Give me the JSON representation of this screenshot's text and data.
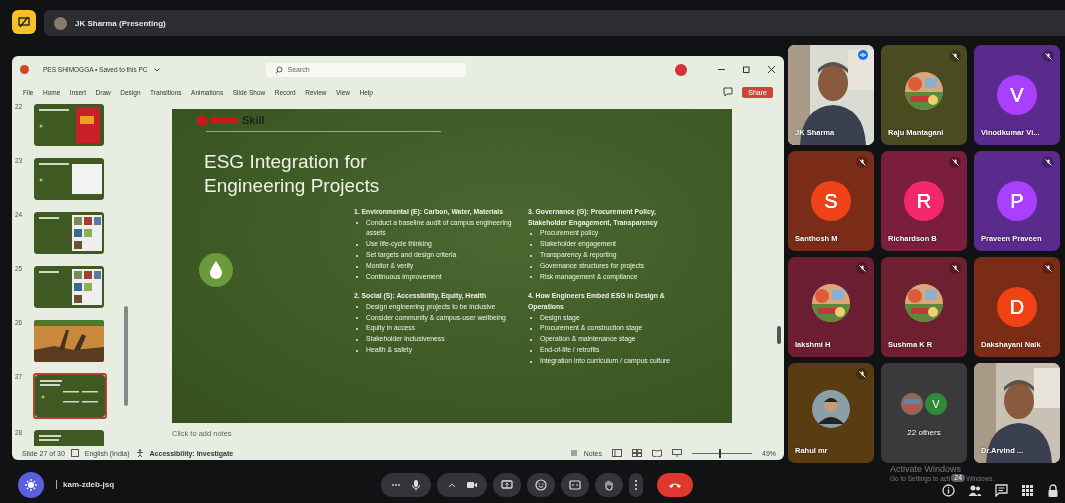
{
  "top_bar": {
    "presenter_label": "JK Sharma (Presenting)"
  },
  "powerpoint": {
    "title": "PES SHIMOGGA • Saved to this PC",
    "search": {
      "placeholder": "Search"
    },
    "ribbon_tabs": [
      "File",
      "Home",
      "Insert",
      "Draw",
      "Design",
      "Transitions",
      "Animations",
      "Slide Show",
      "Record",
      "Review",
      "View",
      "Help"
    ],
    "share_label": "Share",
    "thumbnails": [
      {
        "number": "22",
        "kind": "text-image",
        "selected": false
      },
      {
        "number": "23",
        "kind": "text-document",
        "selected": false
      },
      {
        "number": "24",
        "kind": "photo-grid",
        "selected": false
      },
      {
        "number": "25",
        "kind": "photo-grid",
        "selected": false
      },
      {
        "number": "26",
        "selected": false
      },
      {
        "number": "27",
        "kind": "text",
        "selected": true
      },
      {
        "number": "28",
        "kind": "text",
        "selected": false
      }
    ],
    "slide": {
      "logo_text": "Skill",
      "title": "ESG Integration for Engineering Projects",
      "sections": [
        {
          "heading": "1. Environmental (E): Carbon, Water, Materials",
          "bullets": [
            "Conduct a baseline audit of campus engineering assets",
            "Use life-cycle thinking",
            "Set targets and design criteria",
            "Monitor & verify",
            "Continuous improvement"
          ]
        },
        {
          "heading": "3. Governance (G): Procurement Policy, Stakeholder Engagement, Transparency",
          "bullets": [
            "Procurement policy",
            "Stakeholder engagement",
            "Transparency & reporting",
            "Governance structures for projects",
            "Risk management & compliance"
          ]
        },
        {
          "heading": "2. Social (S): Accessibility, Equity, Health",
          "bullets": [
            "Design engineering projects to be inclusive",
            "Consider community & campus-user wellbeing",
            "Equity in access",
            "Stakeholder inclusiveness",
            "Health & safety"
          ]
        },
        {
          "heading": "4. How Engineers Embed ESG in Design & Operations",
          "bullets": [
            "Design stage",
            "Procurement & construction stage",
            "Operation & maintenance stage",
            "End-of-life / retrofits",
            "Integration into curriculum / campus culture"
          ]
        }
      ]
    },
    "notes_placeholder": "Click to add notes",
    "status_bar": {
      "slide_counter": "Slide 27 of 30",
      "language": "English (India)",
      "accessibility": "Accessibility: Investigate",
      "notes_label": "Notes",
      "zoom": "49%",
      "zoom_slider": {
        "level": 0.45
      }
    }
  },
  "participants": [
    {
      "name": "JK Sharma",
      "kind": "camera",
      "color": "#d9dcd2",
      "muted": false,
      "speaking": true
    },
    {
      "name": "Raju Mantagani",
      "color": "#4b4b22",
      "muted": true,
      "speaking": false
    },
    {
      "name": "Vinodkumar Vi...",
      "kind": "initial",
      "initial": "V",
      "color": "#5a2a8c",
      "muted": true,
      "speaking": false
    },
    {
      "name": "Santhosh M",
      "kind": "initial",
      "initial": "S",
      "color": "#7a2c18",
      "muted": true,
      "speaking": false
    },
    {
      "name": "Richardson B",
      "kind": "initial",
      "initial": "R",
      "color": "#7a1e3c",
      "muted": true,
      "speaking": false
    },
    {
      "name": "Praveen Praveen",
      "kind": "initial",
      "initial": "P",
      "color": "#5a2a8c",
      "muted": true,
      "speaking": false
    },
    {
      "name": "lakshmi H",
      "color": "#6e1e32",
      "muted": true,
      "speaking": false
    },
    {
      "name": "Sushma K R",
      "color": "#6e2030",
      "muted": true,
      "speaking": false
    },
    {
      "name": "Dakshayani Naik",
      "kind": "initial",
      "initial": "D",
      "color": "#7a2c16",
      "muted": true,
      "speaking": false
    },
    {
      "name": "Rahul mr",
      "kind": "person",
      "color": "#5a3c12",
      "muted": true,
      "speaking": false
    },
    {
      "name": "22 others",
      "kind": "others",
      "initial": "V",
      "color": "#3a3a3c",
      "muted": false,
      "speaking": false
    },
    {
      "name": "Dr.Arvind ...",
      "kind": "camera",
      "color": "#c9c2b4",
      "muted": false,
      "speaking": false
    }
  ],
  "bottom_bar": {
    "meeting_code": "kam-zdeb-jsq",
    "people_count": "24"
  },
  "os_notice": {
    "title": "Activate Windows",
    "message_parts": [
      "Go to Settings to acti",
      "Windows."
    ]
  }
}
